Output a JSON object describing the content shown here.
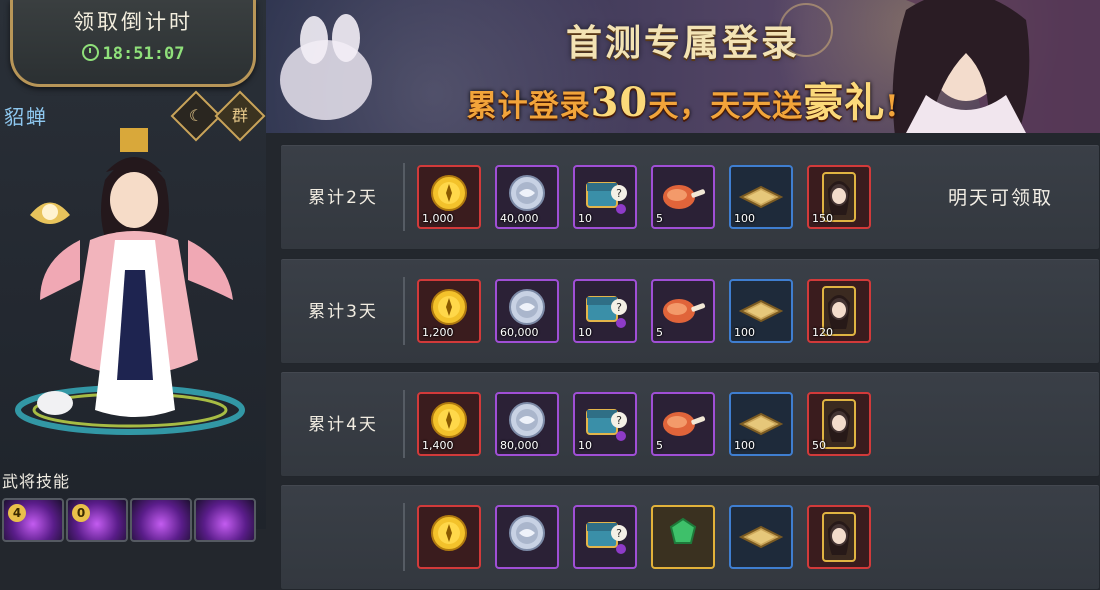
{
  "countdown": {
    "title": "领取倒计时",
    "time": "18:51:07"
  },
  "hero": {
    "name": "貂蝉",
    "faction_badge": "群",
    "camp_badge": ""
  },
  "skills": {
    "label": "武将技能",
    "slots": [
      {
        "level": "4"
      },
      {
        "level": "0"
      },
      {
        "level": ""
      },
      {
        "level": ""
      }
    ]
  },
  "banner": {
    "title": "首测专属登录",
    "subtitle_parts": [
      "累计登录",
      "30",
      "天，天天送",
      "豪礼",
      "!"
    ]
  },
  "rows": [
    {
      "label": "累计2天",
      "status": "明天可领取",
      "items": [
        {
          "icon": "gold-coin-icon",
          "count": "1,000",
          "rarity": "red"
        },
        {
          "icon": "silver-coin-icon",
          "count": "40,000",
          "rarity": "purple"
        },
        {
          "icon": "mystery-chest-icon",
          "count": "10",
          "rarity": "purple"
        },
        {
          "icon": "meat-icon",
          "count": "5",
          "rarity": "purple"
        },
        {
          "icon": "grain-box-icon",
          "count": "100",
          "rarity": "blue"
        },
        {
          "icon": "hero-portrait-icon",
          "count": "150",
          "rarity": "red"
        }
      ]
    },
    {
      "label": "累计3天",
      "status": "",
      "items": [
        {
          "icon": "gold-coin-icon",
          "count": "1,200",
          "rarity": "red"
        },
        {
          "icon": "silver-coin-icon",
          "count": "60,000",
          "rarity": "purple"
        },
        {
          "icon": "mystery-chest-icon",
          "count": "10",
          "rarity": "purple"
        },
        {
          "icon": "meat-icon",
          "count": "5",
          "rarity": "purple"
        },
        {
          "icon": "grain-box-icon",
          "count": "100",
          "rarity": "blue"
        },
        {
          "icon": "hero-portrait-icon",
          "count": "120",
          "rarity": "red"
        }
      ]
    },
    {
      "label": "累计4天",
      "status": "",
      "items": [
        {
          "icon": "gold-coin-icon",
          "count": "1,400",
          "rarity": "red"
        },
        {
          "icon": "silver-coin-icon",
          "count": "80,000",
          "rarity": "purple"
        },
        {
          "icon": "mystery-chest-icon",
          "count": "10",
          "rarity": "purple"
        },
        {
          "icon": "meat-icon",
          "count": "5",
          "rarity": "purple"
        },
        {
          "icon": "grain-box-icon",
          "count": "100",
          "rarity": "blue"
        },
        {
          "icon": "hero-portrait-icon",
          "count": "50",
          "rarity": "red"
        }
      ]
    },
    {
      "label": "",
      "status": "",
      "items": [
        {
          "icon": "gold-coin-icon",
          "count": "",
          "rarity": "red"
        },
        {
          "icon": "silver-coin-icon",
          "count": "",
          "rarity": "purple"
        },
        {
          "icon": "mystery-chest-icon",
          "count": "",
          "rarity": "purple"
        },
        {
          "icon": "jade-icon",
          "count": "",
          "rarity": "gold"
        },
        {
          "icon": "grain-box-icon",
          "count": "",
          "rarity": "blue"
        },
        {
          "icon": "hero-portrait-icon",
          "count": "",
          "rarity": "red"
        }
      ]
    }
  ],
  "colors": {
    "accent_gold": "#b89658",
    "timer_green": "#8fe07a",
    "banner_orange": "#f2a43a",
    "status_white": "#f3efe6"
  }
}
